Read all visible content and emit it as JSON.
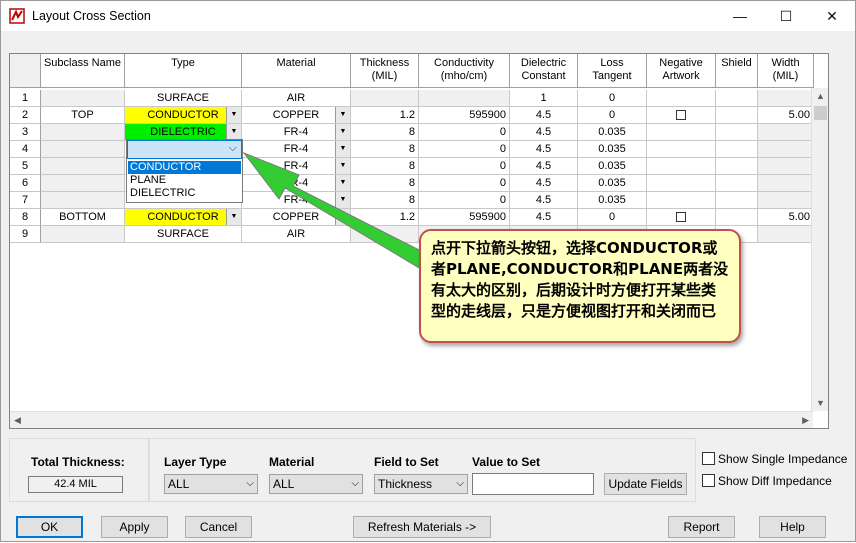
{
  "window": {
    "title": "Layout Cross Section",
    "minimize_glyph": "—",
    "maximize_glyph": "☐",
    "close_glyph": "✕"
  },
  "grid": {
    "headers": [
      "Subclass Name",
      "Type",
      "Material",
      "Thickness\n(MIL)",
      "Conductivity\n(mho/cm)",
      "Dielectric\nConstant",
      "Loss\nTangent",
      "Negative\nArtwork",
      "Shield",
      "Width\n(MIL)"
    ],
    "rows": [
      {
        "num": "1",
        "subclass": "",
        "type": "SURFACE",
        "type_dd": false,
        "type_color": "",
        "material": "AIR",
        "mat_dd": false,
        "thickness": "",
        "conductivity": "",
        "dielectric": "1",
        "loss": "0",
        "negative": false,
        "width": ""
      },
      {
        "num": "2",
        "subclass": "TOP",
        "type": "CONDUCTOR",
        "type_dd": true,
        "type_color": "yellow",
        "material": "COPPER",
        "mat_dd": true,
        "thickness": "1.2",
        "conductivity": "595900",
        "dielectric": "4.5",
        "loss": "0",
        "negative": true,
        "width": "5.00"
      },
      {
        "num": "3",
        "subclass": "",
        "type": "DIELECTRIC",
        "type_dd": true,
        "type_color": "green",
        "material": "FR-4",
        "mat_dd": true,
        "thickness": "8",
        "conductivity": "0",
        "dielectric": "4.5",
        "loss": "0.035",
        "negative": false,
        "width": ""
      },
      {
        "num": "4",
        "subclass": "",
        "type": "",
        "type_dd": false,
        "type_color": "",
        "material": "FR-4",
        "mat_dd": true,
        "thickness": "8",
        "conductivity": "0",
        "dielectric": "4.5",
        "loss": "0.035",
        "negative": false,
        "width": ""
      },
      {
        "num": "5",
        "subclass": "",
        "type": "",
        "type_dd": false,
        "type_color": "",
        "material": "FR-4",
        "mat_dd": true,
        "thickness": "8",
        "conductivity": "0",
        "dielectric": "4.5",
        "loss": "0.035",
        "negative": false,
        "width": ""
      },
      {
        "num": "6",
        "subclass": "",
        "type": "",
        "type_dd": false,
        "type_color": "",
        "material": "FR-4",
        "mat_dd": true,
        "thickness": "8",
        "conductivity": "0",
        "dielectric": "4.5",
        "loss": "0.035",
        "negative": false,
        "width": ""
      },
      {
        "num": "7",
        "subclass": "",
        "type": "",
        "type_dd": false,
        "type_color": "",
        "material": "FR-4",
        "mat_dd": true,
        "thickness": "8",
        "conductivity": "0",
        "dielectric": "4.5",
        "loss": "0.035",
        "negative": false,
        "width": ""
      },
      {
        "num": "8",
        "subclass": "BOTTOM",
        "type": "CONDUCTOR",
        "type_dd": true,
        "type_color": "yellow",
        "material": "COPPER",
        "mat_dd": true,
        "thickness": "1.2",
        "conductivity": "595900",
        "dielectric": "4.5",
        "loss": "0",
        "negative": true,
        "width": "5.00"
      },
      {
        "num": "9",
        "subclass": "",
        "type": "SURFACE",
        "type_dd": false,
        "type_color": "",
        "material": "AIR",
        "mat_dd": false,
        "thickness": "",
        "conductivity": "",
        "dielectric": "",
        "loss": "",
        "negative": false,
        "width": ""
      }
    ],
    "dropdown_options": [
      "CONDUCTOR",
      "PLANE",
      "DIELECTRIC"
    ],
    "dropdown_selected": "CONDUCTOR",
    "colors": {
      "conductor": "#ffff00",
      "dielectric": "#00ee00",
      "selection": "#0078d7"
    }
  },
  "callout": {
    "text": "点开下拉箭头按钮，选择CONDUCTOR或者PLANE,CONDUCTOR和PLANE两者没有太大的区别，后期设计时方便打开某些类型的走线层，只是方便视图打开和关闭而已",
    "arrow_color": "#33cc33"
  },
  "bottom": {
    "total_thickness_label": "Total Thickness:",
    "total_thickness_value": "42.4 MIL",
    "layer_type_label": "Layer Type",
    "layer_type_value": "ALL",
    "material_label": "Material",
    "material_value": "ALL",
    "field_to_set_label": "Field to Set",
    "field_to_set_value": "Thickness",
    "value_to_set_label": "Value to Set",
    "value_to_set_value": "",
    "update_fields_label": "Update Fields",
    "show_single_impedance": "Show Single Impedance",
    "show_diff_impedance": "Show Diff Impedance"
  },
  "buttons": {
    "ok": "OK",
    "apply": "Apply",
    "cancel": "Cancel",
    "refresh_materials": "Refresh Materials ->",
    "report": "Report",
    "help": "Help"
  }
}
